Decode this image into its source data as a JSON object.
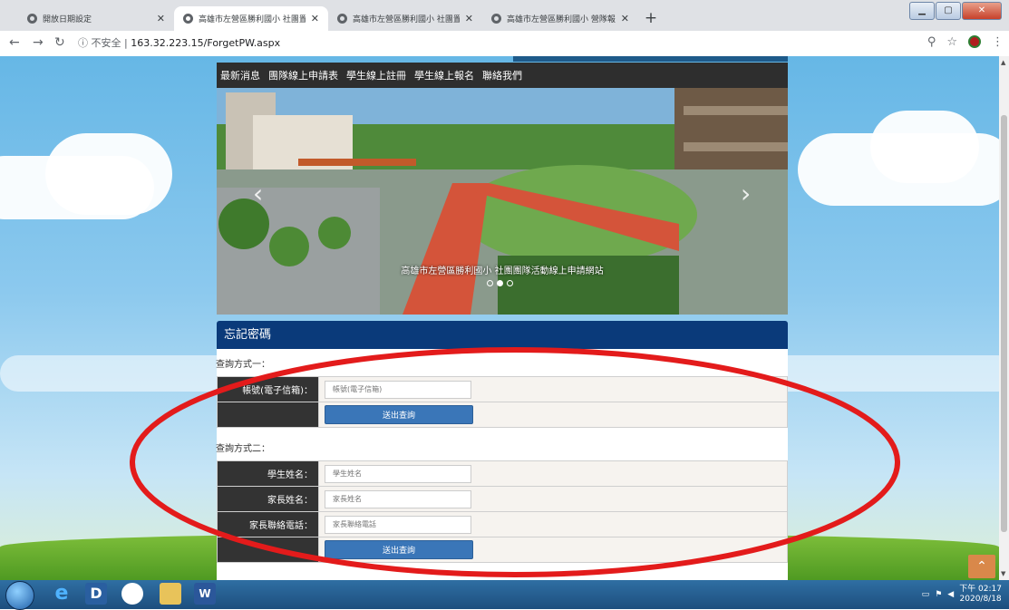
{
  "browser": {
    "tabs": [
      {
        "title": "開放日期設定"
      },
      {
        "title": "高雄市左營區勝利國小 社團置附"
      },
      {
        "title": "高雄市左營區勝利國小 社團置附"
      },
      {
        "title": "高雄市左營區勝利國小 營隊報名"
      }
    ],
    "new_tab_label": "+",
    "address": {
      "security": "不安全",
      "url": "163.32.223.15/ForgetPW.aspx"
    }
  },
  "site": {
    "nav": [
      "最新消息",
      "團隊線上申請表",
      "學生線上註冊",
      "學生線上報名",
      "聯絡我們"
    ],
    "banner_caption": "高雄市左營區勝利國小 社團團隊活動線上申請網站",
    "panel_title": "忘記密碼",
    "method1": {
      "title": "查詢方式一：",
      "account_label": "帳號(電子信箱)：",
      "account_placeholder": "帳號(電子信箱)",
      "submit": "送出查詢"
    },
    "method2": {
      "title": "查詢方式二：",
      "student_label": "學生姓名：",
      "student_placeholder": "學生姓名",
      "parent_label": "家長姓名：",
      "parent_placeholder": "家長姓名",
      "phone_label": "家長聯絡電話：",
      "phone_placeholder": "家長聯絡電話",
      "submit": "送出查詢"
    }
  },
  "taskbar": {
    "clock_time": "下午 02:17",
    "clock_date": "2020/8/18"
  },
  "colors": {
    "panel_header": "#0a3a7a",
    "submit_button": "#3a76b8",
    "annotation_ellipse": "#e31b1b"
  }
}
